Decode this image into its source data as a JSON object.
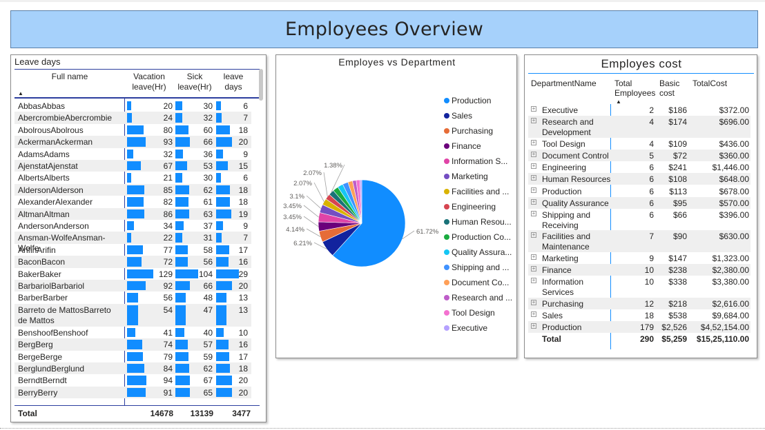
{
  "header": {
    "title": "Employees Overview"
  },
  "leave": {
    "title": "Leave days",
    "columns": {
      "name": "Full name",
      "vacation": "Vacation leave(Hr)",
      "sick": "Sick leave(Hr)",
      "leave": "leave days"
    },
    "sort_icon": "sort-ascending-icon",
    "rows": [
      {
        "name": "AbbasAbbas",
        "vacation": "20",
        "sick": "30",
        "leave": "6"
      },
      {
        "name": "AbercrombieAbercrombie",
        "vacation": "24",
        "sick": "32",
        "leave": "7"
      },
      {
        "name": "AbolrousAbolrous",
        "vacation": "80",
        "sick": "60",
        "leave": "18"
      },
      {
        "name": "AckermanAckerman",
        "vacation": "93",
        "sick": "66",
        "leave": "20"
      },
      {
        "name": "AdamsAdams",
        "vacation": "32",
        "sick": "36",
        "leave": "9"
      },
      {
        "name": "AjenstatAjenstat",
        "vacation": "67",
        "sick": "53",
        "leave": "15"
      },
      {
        "name": "AlbertsAlberts",
        "vacation": "21",
        "sick": "30",
        "leave": "6"
      },
      {
        "name": "AldersonAlderson",
        "vacation": "85",
        "sick": "62",
        "leave": "18"
      },
      {
        "name": "AlexanderAlexander",
        "vacation": "82",
        "sick": "61",
        "leave": "18"
      },
      {
        "name": "AltmanAltman",
        "vacation": "86",
        "sick": "63",
        "leave": "19"
      },
      {
        "name": "AndersonAnderson",
        "vacation": "34",
        "sick": "37",
        "leave": "9"
      },
      {
        "name": "Ansman-WolfeAnsman-Wolfe",
        "vacation": "22",
        "sick": "31",
        "leave": "7"
      },
      {
        "name": "ArifinArifin",
        "vacation": "77",
        "sick": "58",
        "leave": "17"
      },
      {
        "name": "BaconBacon",
        "vacation": "72",
        "sick": "56",
        "leave": "16"
      },
      {
        "name": "BakerBaker",
        "vacation": "129",
        "sick": "104",
        "leave": "29"
      },
      {
        "name": "BarbariolBarbariol",
        "vacation": "92",
        "sick": "66",
        "leave": "20"
      },
      {
        "name": "BarberBarber",
        "vacation": "56",
        "sick": "48",
        "leave": "13"
      },
      {
        "name": "Barreto de MattosBarreto de Mattos",
        "vacation": "54",
        "sick": "47",
        "leave": "13"
      },
      {
        "name": "BenshoofBenshoof",
        "vacation": "41",
        "sick": "40",
        "leave": "10"
      },
      {
        "name": "BergBerg",
        "vacation": "74",
        "sick": "57",
        "leave": "16"
      },
      {
        "name": "BergeBerge",
        "vacation": "79",
        "sick": "59",
        "leave": "17"
      },
      {
        "name": "BerglundBerglund",
        "vacation": "84",
        "sick": "62",
        "leave": "18"
      },
      {
        "name": "BerndtBerndt",
        "vacation": "94",
        "sick": "67",
        "leave": "20"
      },
      {
        "name": "BerryBerry",
        "vacation": "91",
        "sick": "65",
        "leave": "20"
      }
    ],
    "total": {
      "label": "Total",
      "vacation": "14678",
      "sick": "13139",
      "leave": "3477"
    }
  },
  "pie": {
    "title": "Employes vs Department",
    "accent": "#118dff",
    "legend": [
      {
        "label": "Production",
        "color": "#118dff"
      },
      {
        "label": "Sales",
        "color": "#12239e"
      },
      {
        "label": "Purchasing",
        "color": "#e66c37"
      },
      {
        "label": "Finance",
        "color": "#6b007b"
      },
      {
        "label": "Information S...",
        "color": "#e044a7"
      },
      {
        "label": "Marketing",
        "color": "#744ec2"
      },
      {
        "label": "Facilities and ...",
        "color": "#d9b300"
      },
      {
        "label": "Engineering",
        "color": "#d64550"
      },
      {
        "label": "Human Resou...",
        "color": "#197278"
      },
      {
        "label": "Production Co...",
        "color": "#1aab40"
      },
      {
        "label": "Quality Assura...",
        "color": "#15c6f4"
      },
      {
        "label": "Shipping and ...",
        "color": "#4092ff"
      },
      {
        "label": "Document Co...",
        "color": "#ffa058"
      },
      {
        "label": "Research and ...",
        "color": "#be5dc9"
      },
      {
        "label": "Tool Design",
        "color": "#f472d0"
      },
      {
        "label": "Executive",
        "color": "#b5a1ff"
      }
    ],
    "labels": [
      "61.72%",
      "6.21%",
      "4.14%",
      "3.45%",
      "3.45%",
      "3.1%",
      "2.07%",
      "2.07%",
      "1.38%"
    ]
  },
  "chart_data": {
    "type": "pie",
    "title": "Employes vs Department",
    "categories": [
      "Production",
      "Sales",
      "Purchasing",
      "Finance",
      "Information Services",
      "Marketing",
      "Facilities and Maintenance",
      "Engineering",
      "Human Resources",
      "Production Control",
      "Quality Assurance",
      "Shipping and Receiving",
      "Document Control",
      "Research and Development",
      "Tool Design",
      "Executive"
    ],
    "values": [
      179,
      18,
      12,
      10,
      10,
      9,
      7,
      6,
      6,
      6,
      6,
      6,
      5,
      4,
      4,
      2
    ],
    "percent_labels": [
      "61.72%",
      "6.21%",
      "4.14%",
      "3.45%",
      "3.45%",
      "3.1%",
      "2.07%",
      "2.07%",
      "1.38%"
    ]
  },
  "cost": {
    "title": "Employes cost",
    "columns": {
      "dept": "DepartmentName",
      "total": "Total Employees",
      "basic": "Basic cost",
      "totalcost": "TotalCost"
    },
    "rows": [
      {
        "dept": "Executive",
        "total": "2",
        "basic": "$186",
        "totalcost": "$372.00"
      },
      {
        "dept": "Research and Development",
        "total": "4",
        "basic": "$174",
        "totalcost": "$696.00"
      },
      {
        "dept": "Tool Design",
        "total": "4",
        "basic": "$109",
        "totalcost": "$436.00"
      },
      {
        "dept": "Document Control",
        "total": "5",
        "basic": "$72",
        "totalcost": "$360.00"
      },
      {
        "dept": "Engineering",
        "total": "6",
        "basic": "$241",
        "totalcost": "$1,446.00"
      },
      {
        "dept": "Human Resources",
        "total": "6",
        "basic": "$108",
        "totalcost": "$648.00"
      },
      {
        "dept": "Production",
        "total": "6",
        "basic": "$113",
        "totalcost": "$678.00"
      },
      {
        "dept": "Quality Assurance",
        "total": "6",
        "basic": "$95",
        "totalcost": "$570.00"
      },
      {
        "dept": "Shipping and Receiving",
        "total": "6",
        "basic": "$66",
        "totalcost": "$396.00"
      },
      {
        "dept": "Facilities and Maintenance",
        "total": "7",
        "basic": "$90",
        "totalcost": "$630.00"
      },
      {
        "dept": "Marketing",
        "total": "9",
        "basic": "$147",
        "totalcost": "$1,323.00"
      },
      {
        "dept": "Finance",
        "total": "10",
        "basic": "$238",
        "totalcost": "$2,380.00"
      },
      {
        "dept": "Information Services",
        "total": "10",
        "basic": "$338",
        "totalcost": "$3,380.00"
      },
      {
        "dept": "Purchasing",
        "total": "12",
        "basic": "$218",
        "totalcost": "$2,616.00"
      },
      {
        "dept": "Sales",
        "total": "18",
        "basic": "$538",
        "totalcost": "$9,684.00"
      },
      {
        "dept": "Production",
        "total": "179",
        "basic": "$2,526",
        "totalcost": "$4,52,154.00"
      }
    ],
    "total": {
      "label": "Total",
      "total": "290",
      "basic": "$5,259",
      "totalcost": "$15,25,110.00"
    }
  }
}
